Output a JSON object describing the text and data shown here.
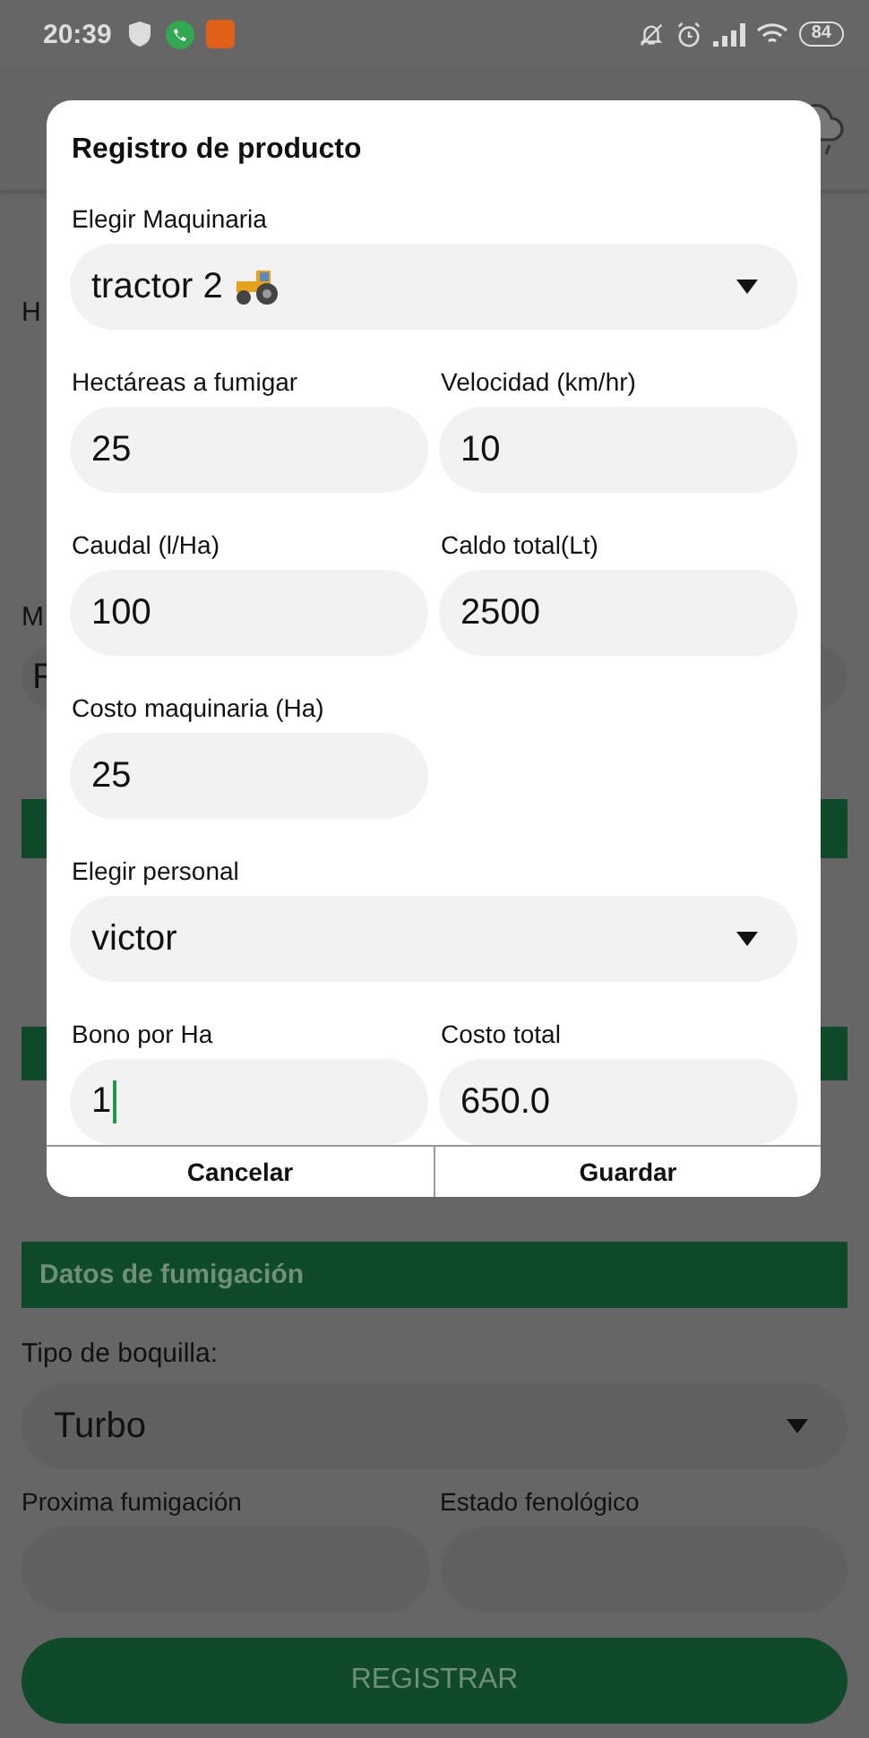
{
  "status_bar": {
    "time": "20:39",
    "battery": "84"
  },
  "background": {
    "label_1": "H",
    "label_2": "M",
    "value_1": "F",
    "section_title": "Datos de fumigación",
    "nozzle_label": "Tipo de boquilla:",
    "nozzle_value": "Turbo",
    "next_label": "Proxima fumigación",
    "phenology_label": "Estado fenológico",
    "submit": "REGISTRAR"
  },
  "dialog": {
    "title": "Registro de producto",
    "fields": [
      {
        "label": "Elegir Maquinaria",
        "value": "tractor 2",
        "kind": "select",
        "icon": true
      },
      {
        "label": "Hectáreas a fumigar",
        "value": "25",
        "kind": "input"
      },
      {
        "label": "Velocidad (km/hr)",
        "value": "10",
        "kind": "input"
      },
      {
        "label": "Caudal (l/Ha)",
        "value": "100",
        "kind": "input"
      },
      {
        "label": "Caldo total(Lt)",
        "value": "2500",
        "kind": "input"
      },
      {
        "label": "Costo maquinaria (Ha)",
        "value": "25",
        "kind": "input"
      },
      {
        "label": "Elegir personal",
        "value": "victor",
        "kind": "select"
      },
      {
        "label": "Bono por Ha",
        "value": "1",
        "kind": "input",
        "focused": true
      },
      {
        "label": "Costo total",
        "value": "650.0",
        "kind": "input"
      }
    ],
    "buttons": [
      "Cancelar",
      "Guardar"
    ]
  }
}
